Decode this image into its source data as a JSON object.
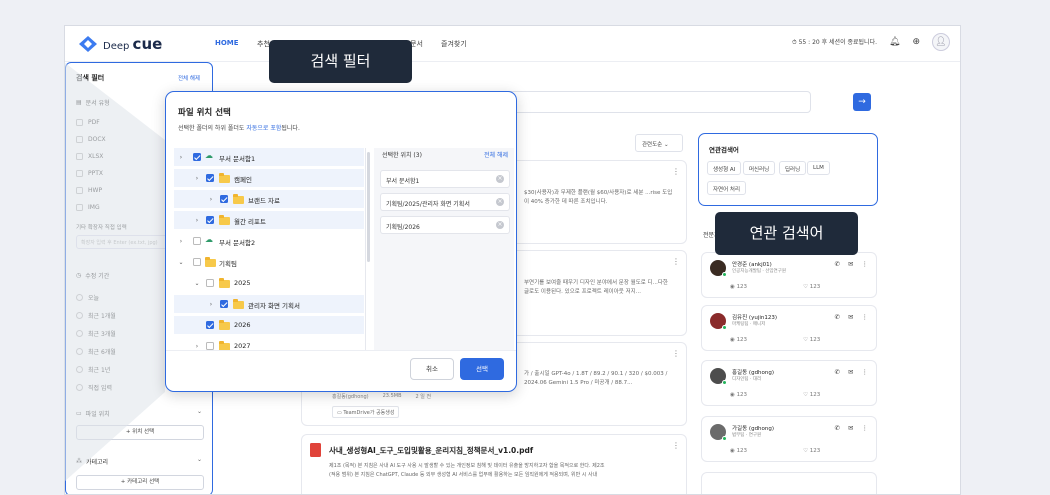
{
  "header": {
    "logo_prefix": "Deep",
    "logo_main": "cue",
    "nav": [
      "HOME",
      "추천",
      "문서",
      "즐겨찾기"
    ],
    "session_text": "55 : 20 후 세션이 종료됩니다."
  },
  "sidebar": {
    "title": "검색 필터",
    "clear_all": "전체 해제",
    "doc_type_label": "문서 유형",
    "doc_types": [
      "PDF",
      "DOCX",
      "XLSX",
      "PPTX",
      "HWP",
      "IMG"
    ],
    "ext_label": "기타 확장자 직접 입력",
    "ext_placeholder": "확장자 입력 후 Enter (ex.txt, jpg)",
    "period_label": "수정 기간",
    "periods": [
      "오늘",
      "최근 1개월",
      "최근 3개월",
      "최근 6개월",
      "최근 1년",
      "직접 입력"
    ],
    "location_label": "파일 위치",
    "location_button": "+ 위치 선택",
    "category_label": "카테고리",
    "category_button": "+ 카테고리 선택"
  },
  "main": {
    "sort_label": "관련도순",
    "experts_label": "전문가",
    "cards": [
      {
        "snippet": "$30(사용자)과 무제한 플랜(월 $60/사용자)로 세분 ...rise 도입이 40% 증가한 데 따른 조치입니다."
      },
      {
        "snippet": "부연기를 보여줄 때우기 디자인 분야에서 문장 월도로 디...다한 글로도 이용된다. 있으로 프로젝트 레이아웃 저지..."
      },
      {
        "snippet": "가 / 출시일 GPT-4o / 1.8T / 89.2 / 90.1 / 320 / $0.003 / 2024.06 Gemini 1.5 Pro / 미공개 / 88.7...",
        "meta_author": "홍길동(gdhong)",
        "meta_size": "23.5MB",
        "meta_date": "2 일 전",
        "tag": "TeamDrive가 공동생성"
      },
      {
        "title": "사내_생성형AI_도구_도입및활용_운리지침_정책문서_v1.0.pdf",
        "snippet1": "제1조 (목적) 본 지침은 사내 AI 도구 사용 시 발생할 수 있는 개인정보 침해 및 데이터 유출을 방지하고자 합을 목적으로 한다. 제2조",
        "snippet2": "(적용 범위) 본 지침은 ChatGPT, Claude 등 외부 생성형 AI 서비스를 업무에 활용하는 모든 임직원에게 적용되며, 위반 시 사내"
      }
    ]
  },
  "related": {
    "title": "연관검색어",
    "chips": [
      "생성형 AI",
      "머신러닝",
      "딥러닝",
      "LLM",
      "자연어 처리"
    ]
  },
  "experts": [
    {
      "name": "안경준 (ankj01)",
      "dept": "인공지능개발팀 · 선임연구원",
      "views": "123",
      "likes": "123"
    },
    {
      "name": "김유진 (yujin123)",
      "dept": "마케팅팀 · 매니저",
      "views": "123",
      "likes": "123"
    },
    {
      "name": "홍길동 (gdhong)",
      "dept": "디자인팀 · 대리",
      "views": "123",
      "likes": "123"
    },
    {
      "name": "가길동 (gdhong)",
      "dept": "법무팀 · 연구원",
      "views": "123",
      "likes": "123"
    }
  ],
  "dialog": {
    "title": "파일 위치 선택",
    "subtitle_pre": "선택한 폴더의 하위 폴더도 ",
    "subtitle_hl": "자동으로 포함",
    "subtitle_post": "됩니다.",
    "tree": [
      {
        "label": "부서 문서함1",
        "checked": true
      },
      {
        "label": "캠페인",
        "checked": true
      },
      {
        "label": "브랜드 자료",
        "checked": true
      },
      {
        "label": "월간 리포트",
        "checked": true
      },
      {
        "label": "부서 문서함2",
        "checked": false
      },
      {
        "label": "기획팀",
        "checked": false
      },
      {
        "label": "2025",
        "checked": false
      },
      {
        "label": "관리자 화면 기획서",
        "checked": true
      },
      {
        "label": "2026",
        "checked": true
      },
      {
        "label": "2027",
        "checked": false
      }
    ],
    "selected_title": "선택한 위치 (3)",
    "selected_clear": "전체 해제",
    "selected": [
      "부서 문서함1",
      "기획팀/2025/관리자 화면 기획서",
      "기획팀/2026"
    ],
    "cancel": "취소",
    "confirm": "선택"
  },
  "callouts": {
    "filter": "검색 필터",
    "related": "연관 검색어"
  },
  "colors": {
    "accent": "#2f6ae0",
    "callout_bg": "#1f2a3a",
    "folder": "#f7c94a"
  }
}
